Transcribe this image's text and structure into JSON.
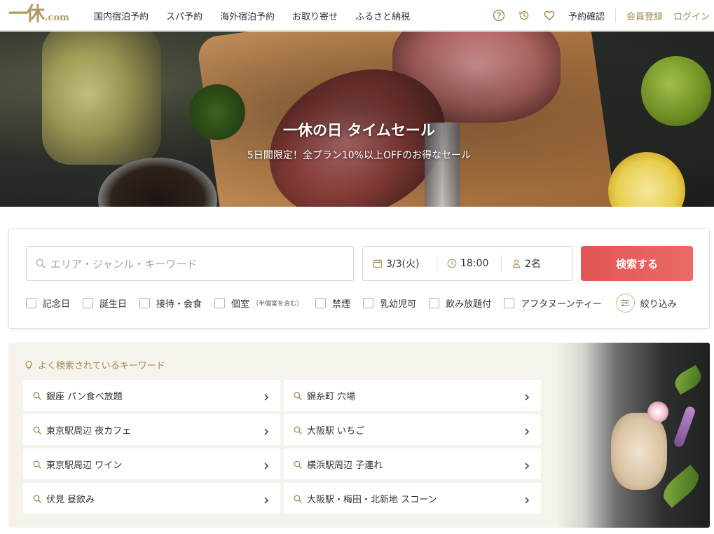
{
  "header": {
    "logo_main": "一休",
    "logo_sub": ".com",
    "nav": [
      "国内宿泊予約",
      "スパ予約",
      "海外宿泊予約",
      "お取り寄せ",
      "ふるさと納税"
    ],
    "icons": [
      "help-icon",
      "history-icon",
      "heart-icon"
    ],
    "reservation_check": "予約確認",
    "register": "会員登録",
    "login": "ログイン"
  },
  "hero": {
    "title": "一休の日 タイムセール",
    "subtitle": "5日間限定！全プラン10%以上OFFのお得なセール"
  },
  "search": {
    "keyword_placeholder": "エリア・ジャンル・キーワード",
    "date": "3/3(火)",
    "time": "18:00",
    "people": "2名",
    "button": "検索する",
    "filters": [
      {
        "label": "記念日",
        "note": ""
      },
      {
        "label": "誕生日",
        "note": ""
      },
      {
        "label": "接待・会食",
        "note": ""
      },
      {
        "label": "個室",
        "note": "（半個室を含む）"
      },
      {
        "label": "禁煙",
        "note": ""
      },
      {
        "label": "乳幼児可",
        "note": ""
      },
      {
        "label": "飲み放題付",
        "note": ""
      },
      {
        "label": "アフタヌーンティー",
        "note": ""
      }
    ],
    "narrow": "絞り込み"
  },
  "keywords": {
    "heading": "よく検索されているキーワード",
    "items": [
      "銀座 パン食べ放題",
      "錦糸町 穴場",
      "東京駅周辺 夜カフェ",
      "大阪駅 いちご",
      "東京駅周辺 ワイン",
      "横浜駅周辺 子連れ",
      "伏見 昼飲み",
      "大阪駅・梅田・北新地 スコーン"
    ]
  },
  "colors": {
    "gold": "#a08a54",
    "search_button": "#e25556",
    "panel_bg": "#f6f3ec"
  }
}
